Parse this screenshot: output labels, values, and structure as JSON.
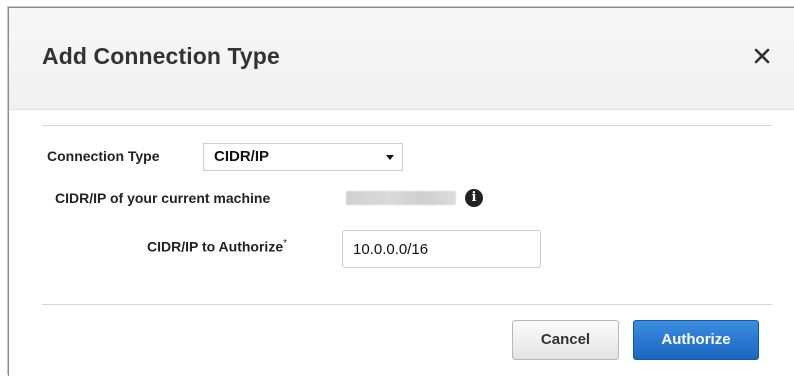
{
  "dialog": {
    "title": "Add Connection Type",
    "close_symbol": "✕"
  },
  "form": {
    "connection_type": {
      "label": "Connection Type",
      "selected": "CIDR/IP"
    },
    "current_machine": {
      "label": "CIDR/IP of your current machine",
      "icon": "info-icon"
    },
    "authorize_cidr": {
      "label": "CIDR/IP to Authorize",
      "required_marker": "*",
      "value": "10.0.0.0/16"
    }
  },
  "footer": {
    "cancel_label": "Cancel",
    "authorize_label": "Authorize"
  },
  "colors": {
    "primary": "#1a66c0",
    "header_bg": "#f4f4f4"
  }
}
